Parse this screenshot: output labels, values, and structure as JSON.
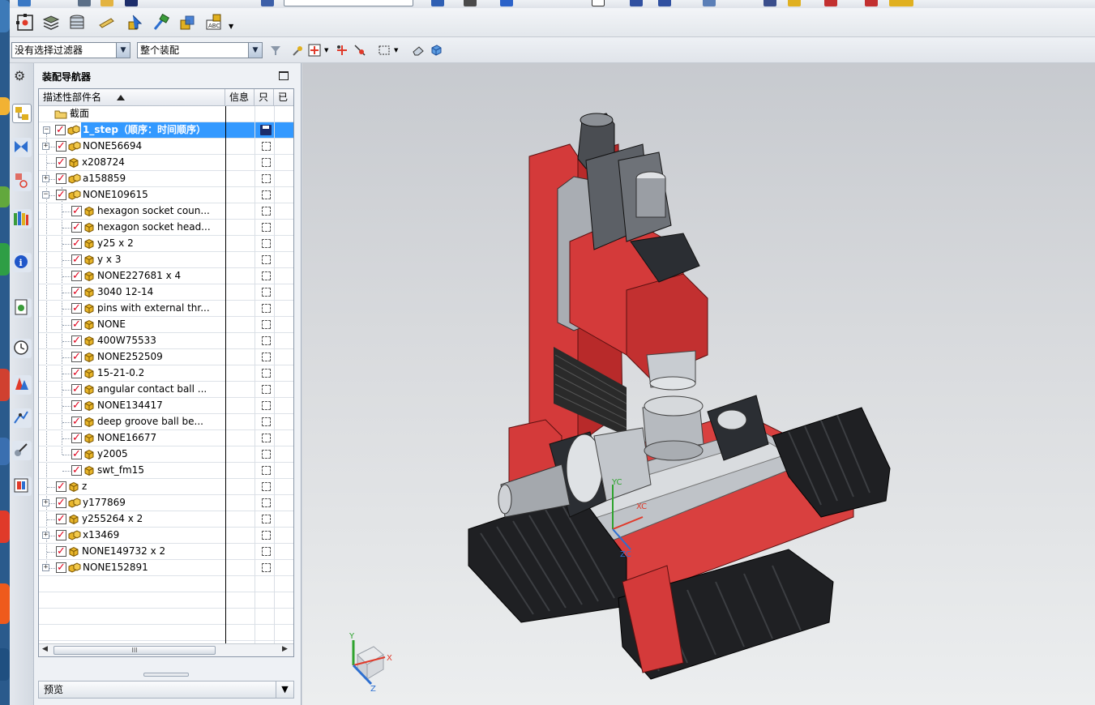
{
  "app": {
    "accent": "#3399ff",
    "check_color": "#e0001b"
  },
  "filters": {
    "selection_filter": "没有选择过滤器",
    "scope": "整个装配"
  },
  "navigator": {
    "title": "装配导航器",
    "columns": {
      "name": "描述性部件名",
      "info": "信息",
      "only": "只",
      "done": "已"
    },
    "section_row": "截面",
    "root_label": "1_step（顺序：时间顺序）",
    "items": [
      {
        "label": "NONE56694",
        "level": 1,
        "expander": "+",
        "type": "assembly"
      },
      {
        "label": "x208724",
        "level": 1,
        "expander": "",
        "type": "part"
      },
      {
        "label": "a158859",
        "level": 1,
        "expander": "+",
        "type": "assembly"
      },
      {
        "label": "NONE109615",
        "level": 1,
        "expander": "-",
        "type": "assembly"
      },
      {
        "label": "hexagon socket coun...",
        "level": 2,
        "expander": "",
        "type": "part"
      },
      {
        "label": "hexagon socket head...",
        "level": 2,
        "expander": "",
        "type": "part"
      },
      {
        "label": "y25 x 2",
        "level": 2,
        "expander": "",
        "type": "part"
      },
      {
        "label": "y x 3",
        "level": 2,
        "expander": "",
        "type": "part"
      },
      {
        "label": "NONE227681 x 4",
        "level": 2,
        "expander": "",
        "type": "part"
      },
      {
        "label": "3040 12-14",
        "level": 2,
        "expander": "",
        "type": "part"
      },
      {
        "label": "pins with external thr...",
        "level": 2,
        "expander": "",
        "type": "part"
      },
      {
        "label": "NONE",
        "level": 2,
        "expander": "",
        "type": "part"
      },
      {
        "label": "400W75533",
        "level": 2,
        "expander": "",
        "type": "part"
      },
      {
        "label": "NONE252509",
        "level": 2,
        "expander": "",
        "type": "part"
      },
      {
        "label": "15-21-0.2",
        "level": 2,
        "expander": "",
        "type": "part"
      },
      {
        "label": "angular contact ball ...",
        "level": 2,
        "expander": "",
        "type": "part"
      },
      {
        "label": "NONE134417",
        "level": 2,
        "expander": "",
        "type": "part"
      },
      {
        "label": "deep groove ball be...",
        "level": 2,
        "expander": "",
        "type": "part"
      },
      {
        "label": "NONE16677",
        "level": 2,
        "expander": "",
        "type": "part"
      },
      {
        "label": "y2005",
        "level": 2,
        "expander": "",
        "type": "part"
      },
      {
        "label": "swt_fm15",
        "level": 2,
        "expander": "",
        "type": "part"
      },
      {
        "label": "z",
        "level": 1,
        "expander": "",
        "type": "part"
      },
      {
        "label": "y177869",
        "level": 1,
        "expander": "+",
        "type": "assembly"
      },
      {
        "label": "y255264 x 2",
        "level": 1,
        "expander": "",
        "type": "part"
      },
      {
        "label": "x13469",
        "level": 1,
        "expander": "+",
        "type": "assembly"
      },
      {
        "label": "NONE149732 x 2",
        "level": 1,
        "expander": "",
        "type": "part"
      },
      {
        "label": "NONE152891",
        "level": 1,
        "expander": "+",
        "type": "assembly"
      }
    ],
    "scroll_grip": "III",
    "preview_label": "预览"
  },
  "viewport": {
    "wcs_x": "XC",
    "wcs_y": "YC",
    "wcs_z": "ZC",
    "triad_x": "X",
    "triad_y": "Y",
    "triad_z": "Z"
  }
}
